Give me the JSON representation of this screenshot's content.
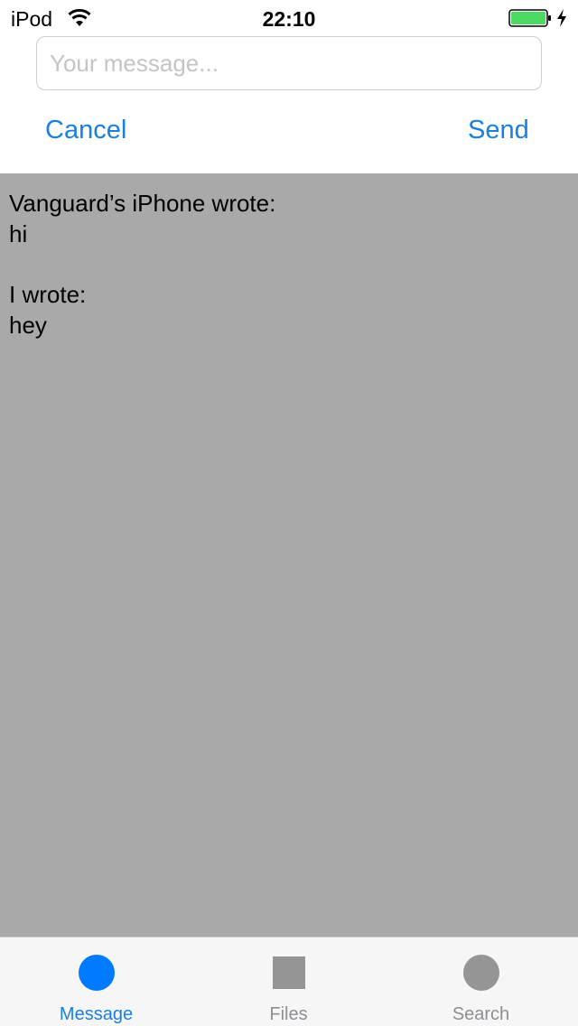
{
  "status_bar": {
    "carrier": "iPod",
    "time": "22:10",
    "battery_level": 1.0,
    "charging": true
  },
  "compose": {
    "placeholder": "Your message...",
    "value": "",
    "cancel_label": "Cancel",
    "send_label": "Send"
  },
  "conversation": [
    {
      "sender": "Vanguard’s iPhone wrote:",
      "text": "hi"
    },
    {
      "sender": "I wrote:",
      "text": "hey"
    }
  ],
  "tab_bar": {
    "tabs": [
      {
        "label": "Message",
        "icon": "circle-icon",
        "selected": true
      },
      {
        "label": "Files",
        "icon": "square-icon",
        "selected": false
      },
      {
        "label": "Search",
        "icon": "circle-icon",
        "selected": false
      }
    ]
  },
  "colors": {
    "accent": "#007aff",
    "link_text": "#1a7fe0",
    "inactive_icon": "#959595",
    "inactive_label": "#8e8e93",
    "conversation_bg": "#a9a9a9",
    "battery_fill": "#4cd964"
  }
}
